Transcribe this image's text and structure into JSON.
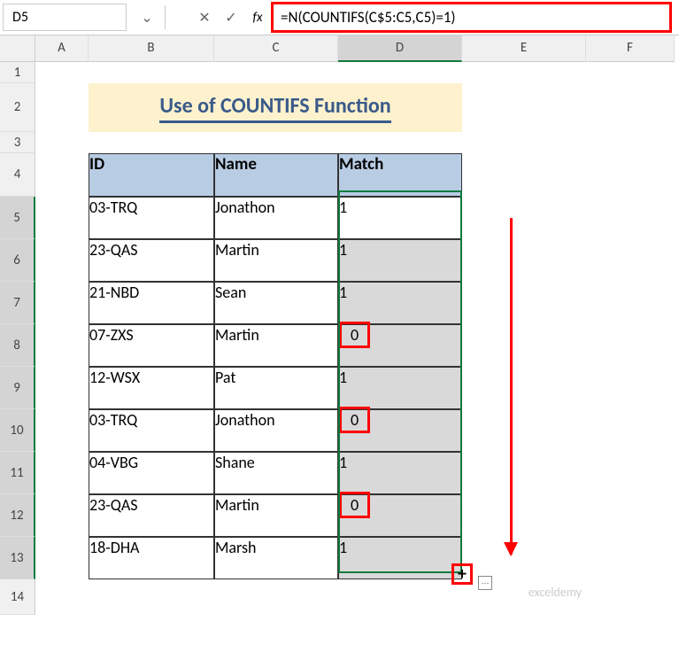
{
  "name_box": "D5",
  "formula": "=N(COUNTIFS(C$5:C5,C5)=1)",
  "columns": [
    "A",
    "B",
    "C",
    "D",
    "E",
    "F"
  ],
  "rows": [
    "1",
    "2",
    "3",
    "4",
    "5",
    "6",
    "7",
    "8",
    "9",
    "10",
    "11",
    "12",
    "13",
    "14"
  ],
  "title": "Use of COUNTIFS Function",
  "headers": {
    "id": "ID",
    "name": "Name",
    "match": "Match"
  },
  "data": [
    {
      "id": "03-TRQ",
      "name": "Jonathon",
      "match": "1",
      "hl": false
    },
    {
      "id": "23-QAS",
      "name": "Martin",
      "match": "1",
      "hl": false
    },
    {
      "id": "21-NBD",
      "name": "Sean",
      "match": "1",
      "hl": false
    },
    {
      "id": "07-ZXS",
      "name": "Martin",
      "match": "0",
      "hl": true
    },
    {
      "id": "12-WSX",
      "name": "Pat",
      "match": "1",
      "hl": false
    },
    {
      "id": "03-TRQ",
      "name": "Jonathon",
      "match": "0",
      "hl": true
    },
    {
      "id": "04-VBG",
      "name": "Shane",
      "match": "1",
      "hl": false
    },
    {
      "id": "23-QAS",
      "name": "Martin",
      "match": "0",
      "hl": true
    },
    {
      "id": "18-DHA",
      "name": "Marsh",
      "match": "1",
      "hl": false
    }
  ],
  "watermark": "exceldemy",
  "chart_data": {
    "type": "table",
    "title": "Use of COUNTIFS Function",
    "columns": [
      "ID",
      "Name",
      "Match"
    ],
    "rows": [
      [
        "03-TRQ",
        "Jonathon",
        1
      ],
      [
        "23-QAS",
        "Martin",
        1
      ],
      [
        "21-NBD",
        "Sean",
        1
      ],
      [
        "07-ZXS",
        "Martin",
        0
      ],
      [
        "12-WSX",
        "Pat",
        1
      ],
      [
        "03-TRQ",
        "Jonathon",
        0
      ],
      [
        "04-VBG",
        "Shane",
        1
      ],
      [
        "23-QAS",
        "Martin",
        0
      ],
      [
        "18-DHA",
        "Marsh",
        1
      ]
    ],
    "formula": "=N(COUNTIFS(C$5:C5,C5)=1)"
  }
}
